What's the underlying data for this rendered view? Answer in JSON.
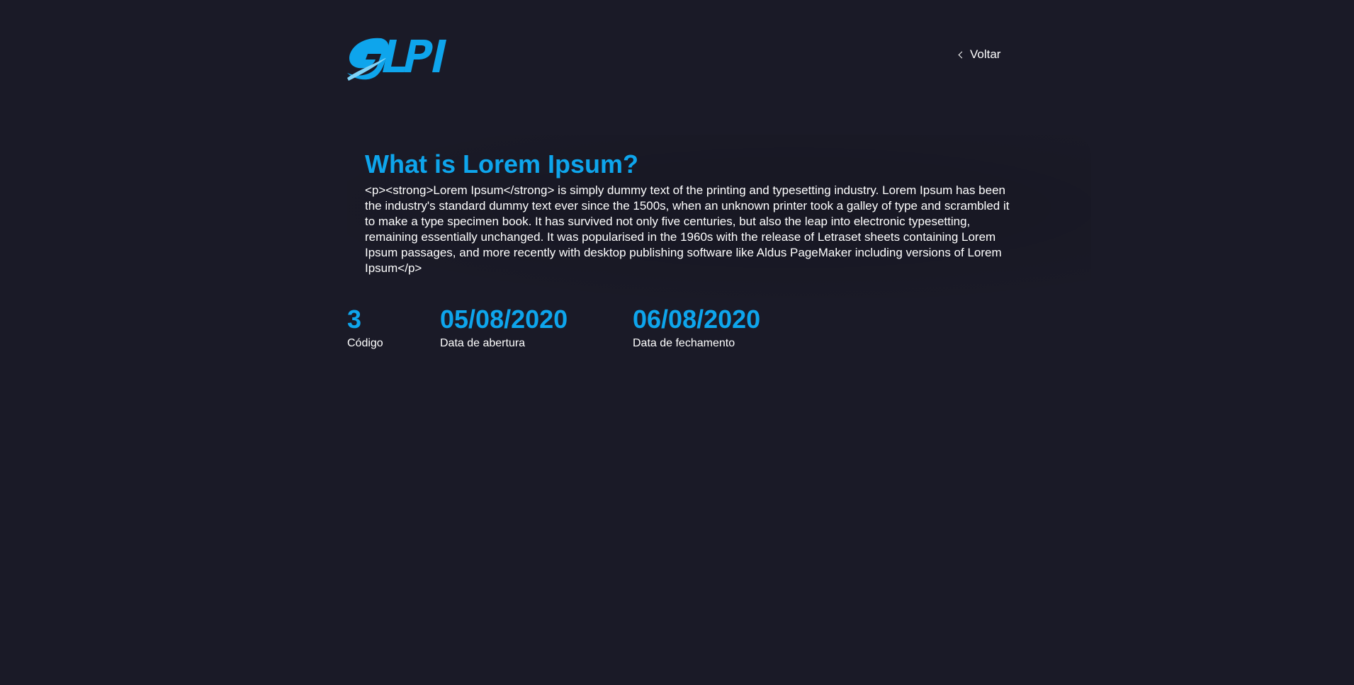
{
  "header": {
    "logo_text": "GLPI",
    "back_label": "Voltar",
    "back_icon": "chevron-left-icon"
  },
  "article": {
    "title": "What is Lorem Ipsum?",
    "body": "<p><strong>Lorem Ipsum</strong> is simply dummy text of the printing and typesetting industry. Lorem Ipsum has been the industry's standard dummy text ever since the 1500s, when an unknown printer took a galley of type and scrambled it to make a type specimen book. It has survived not only five centuries, but also the leap into electronic typesetting, remaining essentially unchanged. It was popularised in the 1960s with the release of Letraset sheets containing Lorem Ipsum passages, and more recently with desktop publishing software like Aldus PageMaker including versions of Lorem Ipsum</p>"
  },
  "stats": {
    "code": {
      "value": "3",
      "label": "Código"
    },
    "opened": {
      "value": "05/08/2020",
      "label": "Data de abertura"
    },
    "closed": {
      "value": "06/08/2020",
      "label": "Data de fechamento"
    }
  },
  "colors": {
    "background": "#1a1a27",
    "accent": "#0ea5ec",
    "text": "#ffffff"
  }
}
